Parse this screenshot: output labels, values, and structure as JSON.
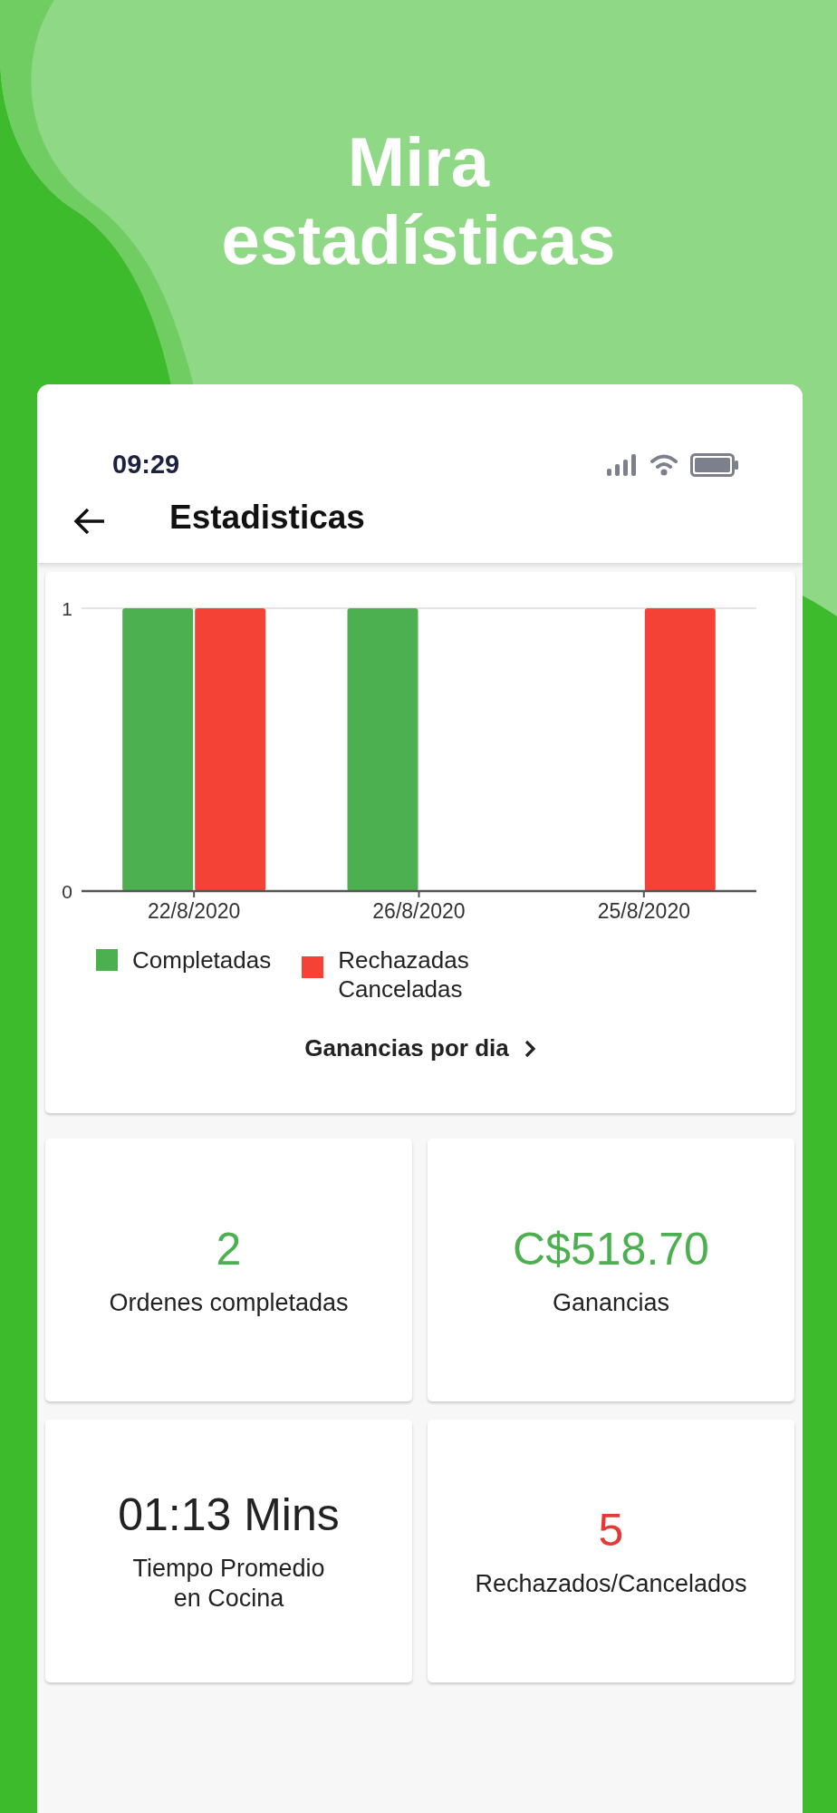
{
  "headline": "Mira\nestadísticas",
  "status_bar": {
    "time": "09:29"
  },
  "app_bar": {
    "title": "Estadisticas"
  },
  "chart": {
    "chart_data": {
      "type": "bar",
      "categories": [
        "22/8/2020",
        "26/8/2020",
        "25/8/2020"
      ],
      "ylim": [
        0,
        1
      ],
      "yticks": [
        0,
        1
      ],
      "series": [
        {
          "name": "Completadas",
          "color": "#4caf50",
          "values": [
            1,
            1,
            0
          ]
        },
        {
          "name": "Rechazadas\nCanceladas",
          "color": "#f44336",
          "values": [
            1,
            0,
            1
          ]
        }
      ]
    },
    "link": "Ganancias por dia"
  },
  "stats": [
    {
      "value": "2",
      "label": "Ordenes completadas",
      "color": "#4caf50"
    },
    {
      "value": "C$518.70",
      "label": "Ganancias",
      "color": "#4caf50"
    },
    {
      "value": "01:13 Mins",
      "label": "Tiempo Promedio\nen Cocina",
      "color": "#222222"
    },
    {
      "value": "5",
      "label": "Rechazados/Cancelados",
      "color": "#e53935"
    }
  ]
}
